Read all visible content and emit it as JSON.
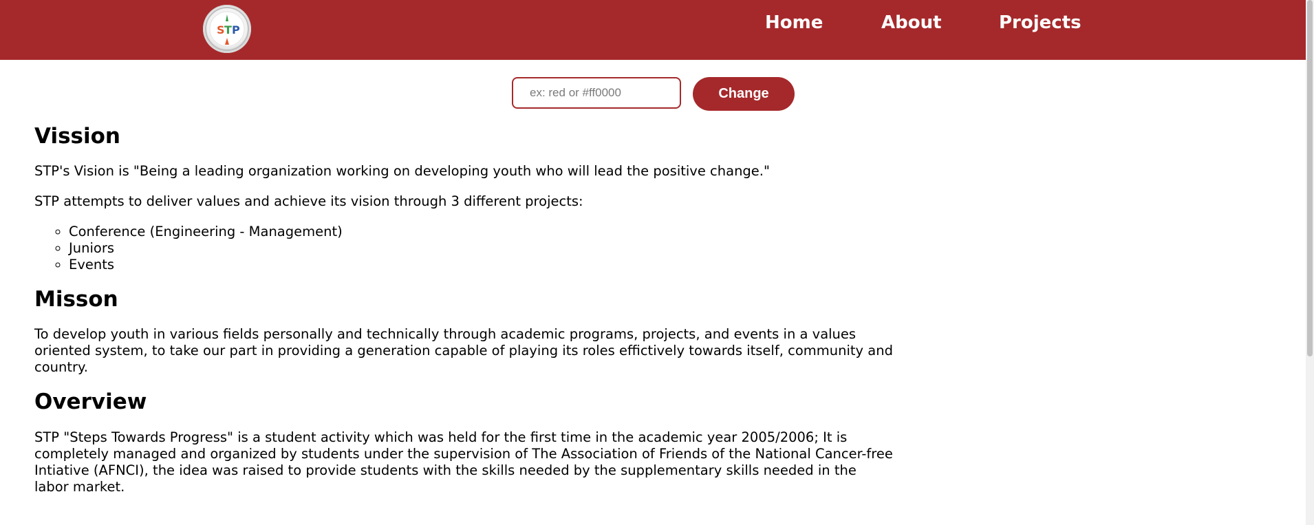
{
  "header": {
    "nav": [
      {
        "label": "Home"
      },
      {
        "label": "About"
      },
      {
        "label": "Projects"
      }
    ]
  },
  "color_changer": {
    "placeholder": "ex: red or #ff0000",
    "button_label": "Change"
  },
  "vision": {
    "heading": "Vission",
    "statement": "STP's Vision is \"Being a leading organization working on developing youth who will lead the positive change.\"",
    "intro": "STP attempts to deliver values and achieve its vision through 3 different projects:",
    "projects": [
      "Conference (Engineering - Management)",
      "Juniors",
      "Events"
    ]
  },
  "mission": {
    "heading": "Misson",
    "text": "To develop youth in various fields personally and technically through academic programs, projects, and events in a values oriented system, to take our part in providing a generation capable of playing its roles effictively towards itself, community and country."
  },
  "overview": {
    "heading": "Overview",
    "text": "STP \"Steps Towards Progress\" is a student activity which was held for the first time in the academic year 2005/2006; It is completely managed and organized by students under the supervision of The Association of Friends of the National Cancer-free Intiative (AFNCI), the idea was raised to provide students with the skills needed by the supplementary skills needed in the labor market."
  },
  "colors": {
    "brand": "#a5292b",
    "background": "#ffffff"
  },
  "icons": {
    "logo": "stp-logo"
  }
}
